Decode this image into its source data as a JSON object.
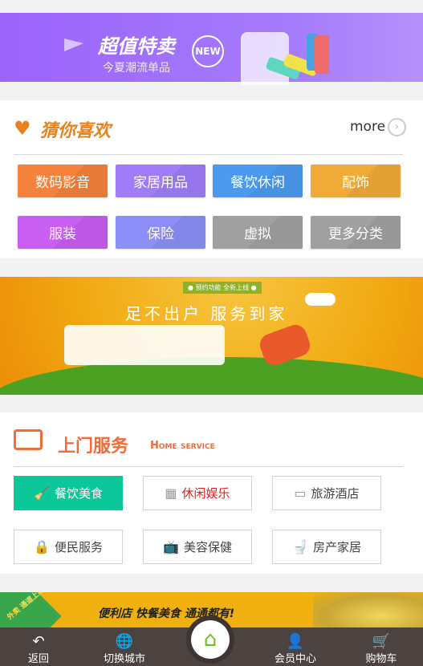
{
  "promo_banner": {
    "title": "超值特卖",
    "subtitle": "今夏潮流单品",
    "badge": "NEW"
  },
  "guess_section": {
    "title": "猜你喜欢",
    "more_label": "more",
    "more_icon": "chevron-right-icon",
    "categories": [
      {
        "label": "数码影音",
        "color": "#f5823a"
      },
      {
        "label": "家居用品",
        "color": "#a07cf8"
      },
      {
        "label": "餐饮休闲",
        "color": "#4b9af0"
      },
      {
        "label": "配饰",
        "color": "#f0aa38"
      },
      {
        "label": "服装",
        "color": "#c85ef2"
      },
      {
        "label": "保险",
        "color": "#8d8ef8"
      },
      {
        "label": "虚拟",
        "color": "#a0a0a0"
      },
      {
        "label": "更多分类",
        "color": "#a0a0a0"
      }
    ]
  },
  "service_banner": {
    "tag": "● 预约功能  全新上线 ●",
    "title": "足不出户  服务到家"
  },
  "home_service": {
    "title": "上门服务",
    "subtitle": "Home service",
    "items": [
      {
        "label": "餐饮美食",
        "icon": "broom-icon",
        "glyph": "🧹",
        "active": true
      },
      {
        "label": "休闲娱乐",
        "icon": "grid-icon",
        "glyph": "▦",
        "highlight": "#e02020"
      },
      {
        "label": "旅游酒店",
        "icon": "air-conditioner-icon",
        "glyph": "▭"
      },
      {
        "label": "便民服务",
        "icon": "lock-icon",
        "glyph": "🔒"
      },
      {
        "label": "美容保健",
        "icon": "tv-icon",
        "glyph": "📺"
      },
      {
        "label": "房产家居",
        "icon": "toilet-icon",
        "glyph": "🚽"
      }
    ]
  },
  "takeaway_banner": {
    "corner": "外卖 通道上线了",
    "text": "便利店  快餐美食  通通都有!"
  },
  "bottom_nav": [
    {
      "label": "返回",
      "icon": "back-arrow-icon",
      "glyph": "↶"
    },
    {
      "label": "切换城市",
      "icon": "globe-icon",
      "glyph": "🌐"
    },
    {
      "label": "会员中心",
      "icon": "user-icon",
      "glyph": "👤"
    },
    {
      "label": "购物车",
      "icon": "cart-icon",
      "glyph": "🛒"
    }
  ],
  "home_button": {
    "icon": "home-icon",
    "glyph": "⌂"
  },
  "colors": {
    "accent_orange": "#e8821e",
    "service_orange": "#f26b3a",
    "active_green": "#0bc79a",
    "nav_bg": "#4c4340",
    "home_green": "#6bbf2a"
  }
}
